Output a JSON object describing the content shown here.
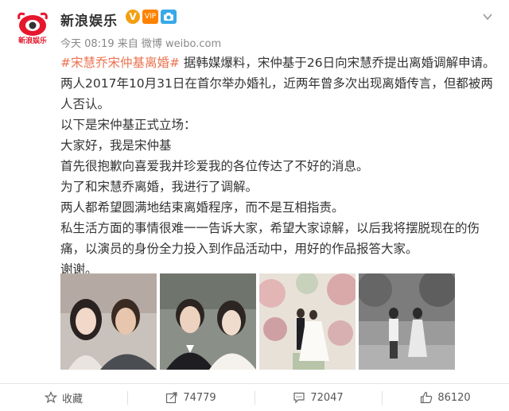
{
  "header": {
    "account_name": "新浪娱乐",
    "avatar_text": "新浪娱乐",
    "badge_v": "V",
    "badge_vip": "VIP",
    "time": "今天 08:19",
    "source_prefix": "来自",
    "source": "微博 weibo.com"
  },
  "post": {
    "topic": "#宋慧乔宋仲基离婚#",
    "line1_rest": " 据韩媒爆料，宋仲基于26日向宋慧乔提出离婚调解申请。两人2017年10月31日在首尔举办婚礼，近两年曾多次出现离婚传言，但都被两人否认。",
    "line2": "以下是宋仲基正式立场：",
    "line3": "大家好，我是宋仲基",
    "line4": "首先很抱歉向喜爱我并珍爱我的各位传达了不好的消息。",
    "line5": "为了和宋慧乔离婚，我进行了调解。",
    "line6": "两人都希望圆满地结束离婚程序，而不是互相指责。",
    "line7": "私生活方面的事情很难一一告诉大家，希望大家谅解，以后我将摆脱现在的伤痛，以演员的身份全力投入到作品活动中，用好的作品报答大家。",
    "line8": "谢谢。"
  },
  "photos": [
    {
      "name": "photo-1"
    },
    {
      "name": "photo-2"
    },
    {
      "name": "photo-3"
    },
    {
      "name": "photo-4"
    }
  ],
  "actions": {
    "favorite_label": "收藏",
    "repost_count": "74779",
    "comment_count": "72047",
    "like_count": "86120"
  },
  "colors": {
    "topic": "#eb7350",
    "vip": "#ff8200",
    "verified": "#f2a012"
  }
}
